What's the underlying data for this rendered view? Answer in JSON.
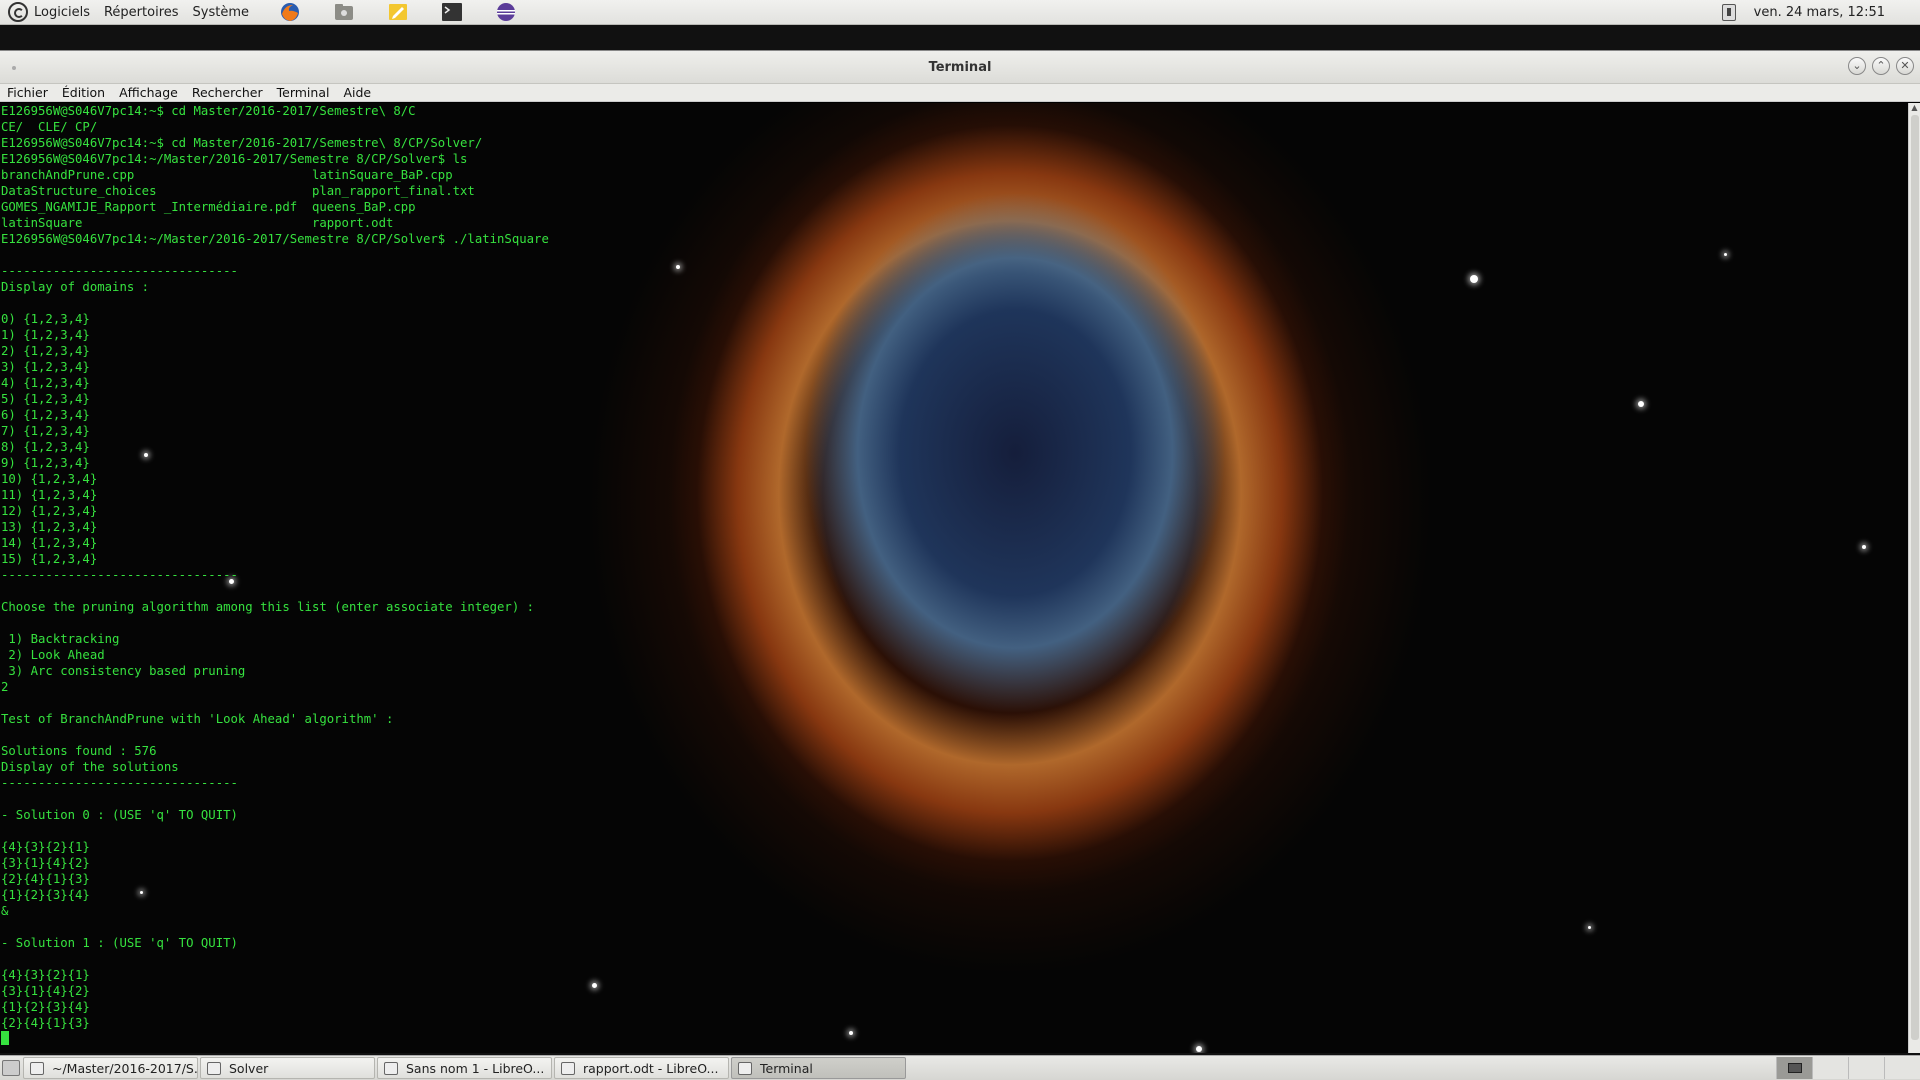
{
  "top_panel": {
    "menus": [
      "Logiciels",
      "Répertoires",
      "Système"
    ],
    "launchers": [
      "firefox-icon",
      "file-manager-icon",
      "text-editor-icon",
      "terminal-icon",
      "eclipse-icon"
    ],
    "clock": "ven. 24 mars, 12:51"
  },
  "window": {
    "title": "Terminal",
    "menus": [
      "Fichier",
      "Édition",
      "Affichage",
      "Rechercher",
      "Terminal",
      "Aide"
    ]
  },
  "terminal": {
    "color": "#36e23f",
    "lines": [
      "E126956W@S046V7pc14:~$ cd Master/2016-2017/Semestre\\ 8/C",
      "CE/  CLE/ CP/",
      "E126956W@S046V7pc14:~$ cd Master/2016-2017/Semestre\\ 8/CP/Solver/",
      "E126956W@S046V7pc14:~/Master/2016-2017/Semestre 8/CP/Solver$ ls",
      "branchAndPrune.cpp                        latinSquare_BaP.cpp",
      "DataStructure_choices                     plan_rapport_final.txt",
      "GOMES_NGAMIJE_Rapport _Intermédiaire.pdf  queens_BaP.cpp",
      "latinSquare                               rapport.odt",
      "E126956W@S046V7pc14:~/Master/2016-2017/Semestre 8/CP/Solver$ ./latinSquare",
      "",
      "--------------------------------",
      "Display of domains :",
      "",
      "0) {1,2,3,4}",
      "1) {1,2,3,4}",
      "2) {1,2,3,4}",
      "3) {1,2,3,4}",
      "4) {1,2,3,4}",
      "5) {1,2,3,4}",
      "6) {1,2,3,4}",
      "7) {1,2,3,4}",
      "8) {1,2,3,4}",
      "9) {1,2,3,4}",
      "10) {1,2,3,4}",
      "11) {1,2,3,4}",
      "12) {1,2,3,4}",
      "13) {1,2,3,4}",
      "14) {1,2,3,4}",
      "15) {1,2,3,4}",
      "--------------------------------",
      "",
      "Choose the pruning algorithm among this list (enter associate integer) :",
      "",
      " 1) Backtracking",
      " 2) Look Ahead",
      " 3) Arc consistency based pruning",
      "2",
      "",
      "Test of BranchAndPrune with 'Look Ahead' algorithm' :",
      "",
      "Solutions found : 576",
      "Display of the solutions",
      "--------------------------------",
      "",
      "- Solution 0 : (USE 'q' TO QUIT)",
      "",
      "{4}{3}{2}{1}",
      "{3}{1}{4}{2}",
      "{2}{4}{1}{3}",
      "{1}{2}{3}{4}",
      "&",
      "",
      "- Solution 1 : (USE 'q' TO QUIT)",
      "",
      "{4}{3}{2}{1}",
      "{3}{1}{4}{2}",
      "{1}{2}{3}{4}",
      "{2}{4}{1}{3}"
    ]
  },
  "taskbar": {
    "tasks": [
      {
        "label": "~/Master/2016-2017/S...",
        "icon": "terminal-icon",
        "active": false
      },
      {
        "label": "Solver",
        "icon": "folder-icon",
        "active": false
      },
      {
        "label": "Sans nom 1 - LibreO...",
        "icon": "document-icon",
        "active": false
      },
      {
        "label": "rapport.odt - LibreO...",
        "icon": "document-icon",
        "active": false
      },
      {
        "label": "Terminal",
        "icon": "terminal-icon",
        "active": true
      }
    ]
  }
}
